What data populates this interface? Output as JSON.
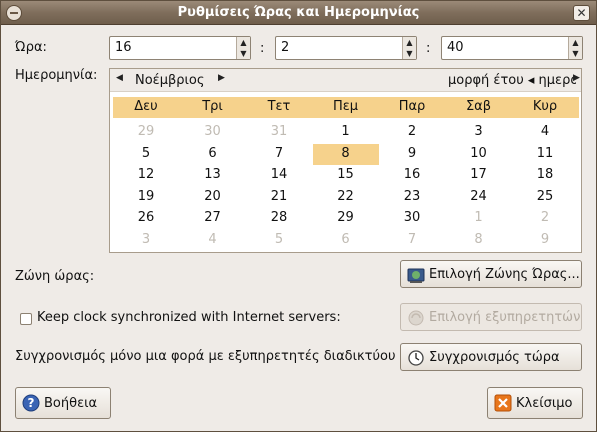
{
  "window": {
    "title": "Ρυθμίσεις Ώρας και Ημερομηνίας",
    "close_symbol": "✕"
  },
  "time": {
    "label": "Ώρα:",
    "hour": "16",
    "minute": "2",
    "second": "40",
    "separator": ":"
  },
  "date": {
    "label": "Ημερομηνία:",
    "month": "Νοέμβριος",
    "year_area_text": "μορφή έτου ◂ ημερο",
    "weekdays": [
      "Δευ",
      "Τρι",
      "Τετ",
      "Πεμ",
      "Παρ",
      "Σαβ",
      "Κυρ"
    ],
    "weeks": [
      [
        "29",
        "30",
        "31",
        "1",
        "2",
        "3",
        "4"
      ],
      [
        "5",
        "6",
        "7",
        "8",
        "9",
        "10",
        "11"
      ],
      [
        "12",
        "13",
        "14",
        "15",
        "16",
        "17",
        "18"
      ],
      [
        "19",
        "20",
        "21",
        "22",
        "23",
        "24",
        "25"
      ],
      [
        "26",
        "27",
        "28",
        "29",
        "30",
        "1",
        "2"
      ],
      [
        "3",
        "4",
        "5",
        "6",
        "7",
        "8",
        "9"
      ]
    ],
    "selected_day": "8"
  },
  "timezone": {
    "label": "Ζώνη ώρας:",
    "button": "Επιλογή Ζώνης Ώρας..."
  },
  "sync": {
    "checkbox_label": "Keep clock synchronized with Internet servers:",
    "servers_button": "Επιλογή εξυπηρετητών",
    "once_label": "Συγχρονισμός μόνο μια φορά με εξυπηρετητές διαδικτύου",
    "now_button": "Συγχρονισμός τώρα"
  },
  "footer": {
    "help": "Βοήθεια",
    "close": "Κλείσιμο"
  },
  "colors": {
    "accent": "#f6d28c",
    "titlebar": "#7f6e5c",
    "background": "#efebe7"
  }
}
